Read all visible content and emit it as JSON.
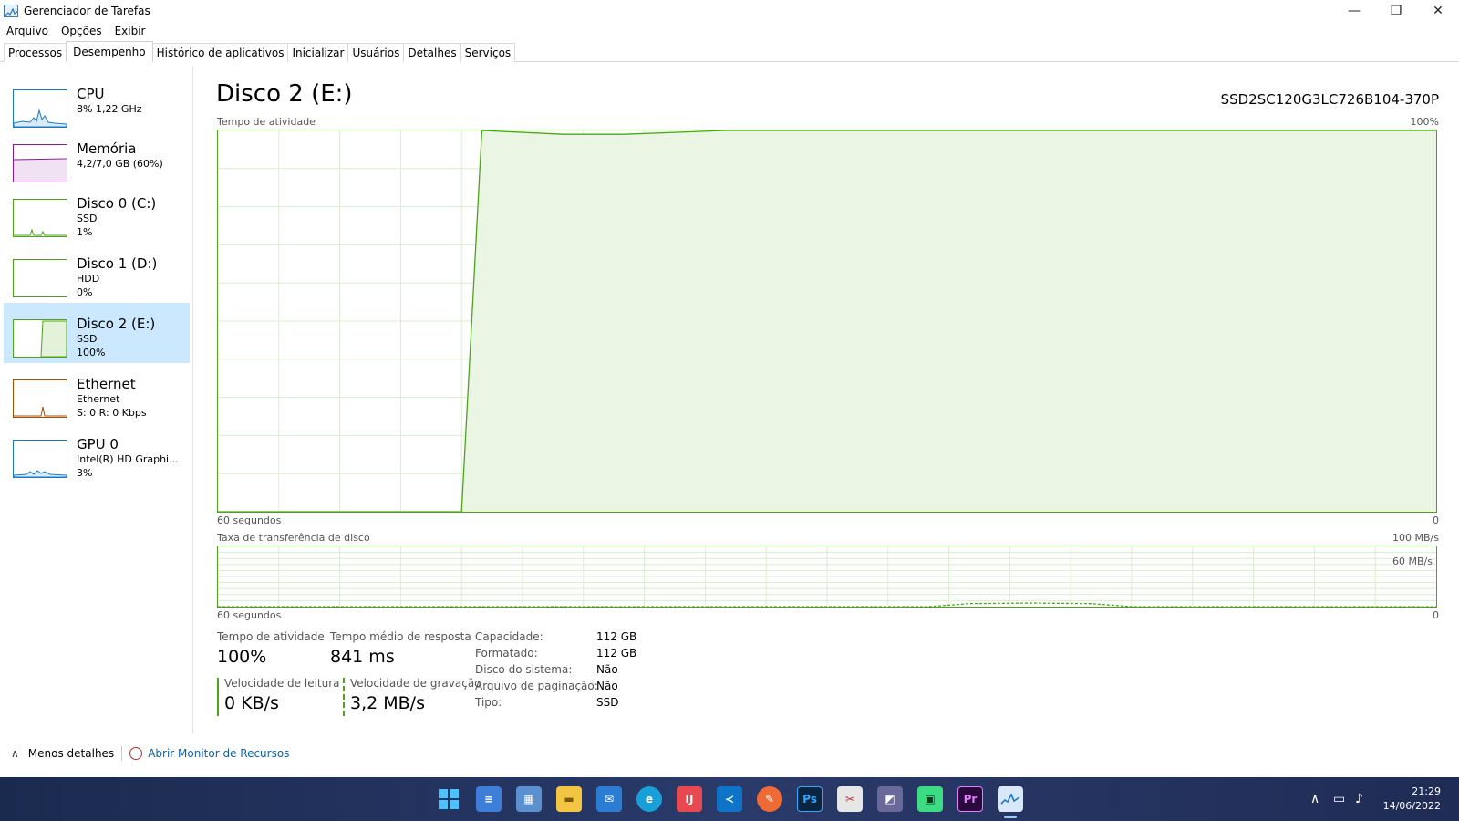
{
  "window": {
    "title": "Gerenciador de Tarefas",
    "controls": {
      "minimize": "—",
      "maximize": "❐",
      "close": "✕"
    }
  },
  "menu": [
    "Arquivo",
    "Opções",
    "Exibir"
  ],
  "tabs": [
    "Processos",
    "Desempenho",
    "Histórico de aplicativos",
    "Inicializar",
    "Usuários",
    "Detalhes",
    "Serviços"
  ],
  "active_tab": "Desempenho",
  "sidebar": {
    "items": [
      {
        "title": "CPU",
        "line1": "8% 1,22 GHz",
        "line2": ""
      },
      {
        "title": "Memória",
        "line1": "4,2/7,0 GB (60%)",
        "line2": ""
      },
      {
        "title": "Disco 0 (C:)",
        "line1": "SSD",
        "line2": "1%"
      },
      {
        "title": "Disco 1 (D:)",
        "line1": "HDD",
        "line2": "0%"
      },
      {
        "title": "Disco 2 (E:)",
        "line1": "SSD",
        "line2": "100%"
      },
      {
        "title": "Ethernet",
        "line1": "Ethernet",
        "line2": "S: 0 R: 0 Kbps"
      },
      {
        "title": "GPU 0",
        "line1": "Intel(R) HD Graphi...",
        "line2": "3%"
      }
    ],
    "selected_index": 4,
    "colors": [
      "#1b7ac8",
      "#8b1a9a",
      "#4ca41c",
      "#4ca41c",
      "#4ca41c",
      "#a74f01",
      "#1b7ac8"
    ]
  },
  "main": {
    "title": "Disco 2 (E:)",
    "model": "SSD2SC120G3LC726B104-370P",
    "activity_graph": {
      "label": "Tempo de atividade",
      "max_label": "100%",
      "time_label": "60 segundos",
      "zero_label": "0"
    },
    "transfer_graph": {
      "label": "Taxa de transferência de disco",
      "max_label": "100 MB/s",
      "mid_label": "60 MB/s",
      "time_label": "60 segundos",
      "zero_label": "0"
    },
    "stats": {
      "activity_label": "Tempo de atividade",
      "activity_value": "100%",
      "response_label": "Tempo médio de resposta",
      "response_value": "841 ms",
      "read_label": "Velocidade de leitura",
      "read_value": "0 KB/s",
      "write_label": "Velocidade de gravação",
      "write_value": "3,2 MB/s"
    },
    "properties": [
      {
        "key": "Capacidade:",
        "value": "112 GB"
      },
      {
        "key": "Formatado:",
        "value": "112 GB"
      },
      {
        "key": "Disco do sistema:",
        "value": "Não"
      },
      {
        "key": "Arquivo de paginação:",
        "value": "Não"
      },
      {
        "key": "Tipo:",
        "value": "SSD"
      }
    ]
  },
  "footer": {
    "less_details": "Menos detalhes",
    "resource_monitor": "Abrir Monitor de Recursos"
  },
  "taskbar": {
    "time": "21:29",
    "date": "14/06/2022",
    "apps": [
      "windows-start",
      "notepad",
      "control-panel",
      "file-explorer",
      "mail",
      "edge",
      "intellij",
      "vscode",
      "postman",
      "photoshop",
      "snipping",
      "app-gray",
      "android-studio",
      "premiere",
      "task-manager"
    ]
  },
  "chart_data": [
    {
      "type": "area",
      "title": "Tempo de atividade",
      "xlabel": "60 segundos",
      "ylim": [
        0,
        100
      ],
      "x": [
        60,
        49,
        48,
        47,
        43,
        40,
        35,
        30,
        25,
        20,
        15,
        10,
        5,
        0
      ],
      "values": [
        0,
        0,
        0,
        100,
        99,
        99,
        100,
        100,
        100,
        100,
        100,
        100,
        100,
        100
      ]
    },
    {
      "type": "line",
      "title": "Taxa de transferência de disco",
      "xlabel": "60 segundos",
      "ylim": [
        0,
        100
      ],
      "x": [
        60,
        25,
        23,
        20,
        17,
        15,
        0
      ],
      "values": [
        0,
        0,
        5,
        6,
        5,
        0,
        0
      ]
    }
  ]
}
